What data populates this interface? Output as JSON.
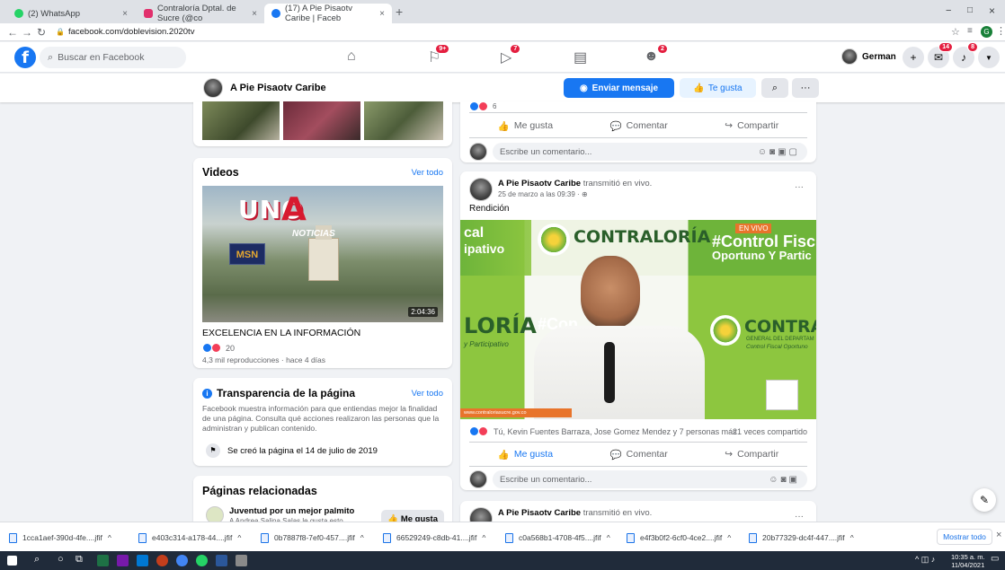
{
  "browser": {
    "tabs": [
      {
        "label": "(2) WhatsApp",
        "close": "×"
      },
      {
        "label": "Contraloría Dptal. de Sucre (@co",
        "close": "×"
      },
      {
        "label": "(17) A Pie Pisaotv Caribe | Faceb",
        "close": "×"
      }
    ],
    "new_tab": "+",
    "url": "facebook.com/doblevision.2020tv",
    "window_controls": [
      "−",
      "□",
      "×"
    ],
    "profile_letter": "G",
    "colors": {
      "whatsapp": "#25d366",
      "instagram": "#e1306c",
      "facebook": "#1877f2"
    }
  },
  "fb_header": {
    "logo": "f",
    "search_placeholder": "Buscar en Facebook",
    "nav_badges": {
      "pages": "9+",
      "watch": "7",
      "groups": "2"
    },
    "user_name": "German",
    "right_badges": {
      "messenger": "14",
      "notifications": "8"
    }
  },
  "page_bar": {
    "page_name": "A Pie Pisaotv Caribe",
    "send_message": "Enviar mensaje",
    "liked": "Te gusta",
    "more": "···"
  },
  "videos_card": {
    "title": "Videos",
    "see_all": "Ver todo",
    "thumb_logo_top": "UNO",
    "thumb_logo_bottom": "NOTICIAS",
    "thumb_badge": "MSN",
    "duration": "2:04:36",
    "video_title": "EXCELENCIA EN LA INFORMACIÓN",
    "reactions_count": "20",
    "meta": "4,3 mil reproducciones · hace 4 días"
  },
  "transparency_card": {
    "title": "Transparencia de la página",
    "see_all": "Ver todo",
    "description": "Facebook muestra información para que entiendas mejor la finalidad de una página. Consulta qué acciones realizaron las personas que la administran y publican contenido.",
    "created": "Se creó la página el 14 de julio de 2019"
  },
  "related_card": {
    "title": "Páginas relacionadas",
    "item_name": "Juventud por un mejor palmito",
    "item_sub": "A Andrea Salina Salas le gusta esto",
    "item_button": "Me gusta"
  },
  "post_top": {
    "reactions_count": "6",
    "like": "Me gusta",
    "comment": "Comentar",
    "share": "Compartir",
    "comment_placeholder": "Escribe un comentario..."
  },
  "post_main": {
    "author": "A Pie Pisaotv Caribe",
    "action": "transmitió en vivo.",
    "date": "25 de marzo a las 09:39 · ",
    "text": "Rendición",
    "live_badge": "EN VIVO",
    "video_text_left_top": "cal",
    "video_text_left_mid": "ipativo",
    "video_text_contraloria": "CONTRALORÍA",
    "video_text_right": "#Control Fisc",
    "video_text_right2": "Oportuno Y Partic",
    "video_text_loria": "LORÍA",
    "video_text_con": "#Con",
    "video_text_contrai": "CONTRAI",
    "video_sub_right": "GENERAL DEL DEPARTAM",
    "video_sub_right2": "Control Fiscal Oportuno",
    "video_text_left_small": "y Participativo",
    "video_url_strip": "www.contraloriasucre.gov.co",
    "reactions_text": "Tú, Kevin Fuentes Barraza, Jose Gomez Mendez y 7 personas más",
    "shares": "21 veces compartido",
    "like": "Me gusta",
    "comment": "Comentar",
    "share": "Compartir",
    "comment_placeholder": "Escribe un comentario..."
  },
  "post_next": {
    "author": "A Pie Pisaotv Caribe",
    "action": "transmitió en vivo."
  },
  "downloads": {
    "items": [
      "1cca1aef-390d-4fe....jfif",
      "e403c314-a178-44....jfif",
      "0b7887f8-7ef0-457....jfif",
      "66529249-c8db-41....jfif",
      "c0a568b1-4708-4f5....jfif",
      "e4f3b0f2-6cf0-4ce2....jfif",
      "20b77329-dc4f-447....jfif"
    ],
    "show_all": "Mostrar todo",
    "close": "×"
  },
  "taskbar": {
    "time": "10:35 a. m.",
    "date": "11/04/2021"
  }
}
